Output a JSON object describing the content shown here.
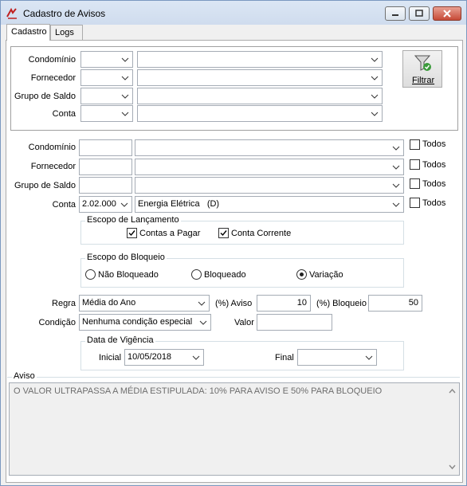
{
  "window": {
    "title": "Cadastro de Avisos"
  },
  "tabs": [
    {
      "label": "Cadastro",
      "active": true
    },
    {
      "label": "Logs",
      "active": false
    }
  ],
  "filter": {
    "condominio_label": "Condomínio",
    "fornecedor_label": "Fornecedor",
    "grupo_label": "Grupo de Saldo",
    "conta_label": "Conta",
    "button_label": "Filtrar"
  },
  "form": {
    "condominio_label": "Condomínio",
    "fornecedor_label": "Fornecedor",
    "grupo_label": "Grupo de Saldo",
    "conta_label": "Conta",
    "conta_code": "2.02.000",
    "conta_name": "Energia Elétrica   (D)",
    "todos_label": "Todos",
    "escopo_lancamento": {
      "title": "Escopo de Lançamento",
      "contas_pagar": "Contas a Pagar",
      "contas_pagar_checked": true,
      "conta_corrente": "Conta Corrente",
      "conta_corrente_checked": true
    },
    "escopo_bloqueio": {
      "title": "Escopo do Bloqueio",
      "options": [
        "Não Bloqueado",
        "Bloqueado",
        "Variação"
      ],
      "selected": "Variação"
    },
    "regra_label": "Regra",
    "regra_value": "Média do Ano",
    "aviso_pct_label": "(%) Aviso",
    "aviso_pct_value": "10",
    "bloqueio_pct_label": "(%) Bloqueio",
    "bloqueio_pct_value": "50",
    "condicao_label": "Condição",
    "condicao_value": "Nenhuma condição especial",
    "valor_label": "Valor",
    "valor_value": "",
    "vigencia": {
      "title": "Data de Vigência",
      "inicial_label": "Inicial",
      "inicial_value": "10/05/2018",
      "final_label": "Final",
      "final_value": ""
    }
  },
  "aviso": {
    "label": "Aviso",
    "text": "O VALOR ULTRAPASSA A MÉDIA ESTIPULADA: 10% PARA AVISO E 50% PARA BLOQUEIO"
  }
}
